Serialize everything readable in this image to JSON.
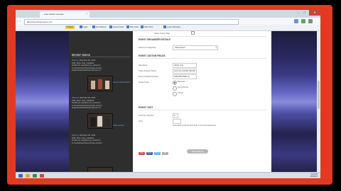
{
  "browser": {
    "tab_title": "Free Online Courses",
    "url": "www.freeonlinecourse.com",
    "window_controls": [
      "–",
      "□",
      "✕"
    ]
  },
  "bookmarks": [
    "Toolbar",
    "Apps",
    "Get Started",
    "Latest News",
    "Site Links",
    "Web Slice",
    "Login Websites"
  ],
  "sidebar": {
    "section_title": "RECENT VIDEOS",
    "posts": [
      {
        "title": "Warning:",
        "meta": "Wed Sep 3rd, 2014",
        "lines": [
          "PHP_Strict_Only_variables",
          "should_be_assigned_by_reference",
          "in /home/content/courses/wp-content",
          "plugins/wpinclude/index.php line 41"
        ],
        "link": "How to Add an Event"
      },
      {
        "title": "Warning:",
        "meta": "Wed Sep 3rd, 2014",
        "lines": [
          "PHP_Strict_Only_variables",
          "should_be_assigned_by_reference",
          "in /home/content/courses/wp-content",
          "plugins/wpinclude/index.php line 41"
        ],
        "link": "Video Lesson"
      },
      {
        "title": "Warning:",
        "meta": "Wed Sep 3rd, 2014",
        "lines": [
          "PHP_Strict_Only_variables",
          "should_be_assigned_by_reference",
          "in /home/content/courses/wp-content"
        ],
        "link": ""
      }
    ]
  },
  "form": {
    "top_label": "Show Online Map",
    "organizer_heading": "EVENT ORGANIZER DETAILS",
    "organizer_label": "Select an Organizer",
    "organizer_value": "Select Event",
    "custom_heading": "EVENT CUSTOM FIELDS",
    "fields": [
      {
        "label": "Attendees",
        "value": "Adults Only"
      },
      {
        "label": "Type of Event Show",
        "value": "Live Fine Arts Bar Mitzvah"
      },
      {
        "label": "Event Contact Number",
        "value": "0203-456-7890 ext"
      }
    ],
    "radio_label": "Dress Code",
    "radios": [
      "Business",
      "Semi-Formal",
      "Casual"
    ],
    "cost_heading": "EVENT COST",
    "currency_label": "Currency Symbol",
    "currency_value": "$",
    "cost_label": "Cost",
    "cost_help": "Leave blank to hide the field. Enter 0 for events that are free.",
    "submit_label": "Submit Event"
  },
  "social": [
    "Like",
    "Tweet",
    "Share",
    "Pin"
  ],
  "taskbar": {
    "time": "6:22 AM",
    "date": "9/3/2014"
  },
  "colors": {
    "frame": "#e23a22",
    "sidebar": "#2e2e2e",
    "link": "#7fa9e0"
  }
}
